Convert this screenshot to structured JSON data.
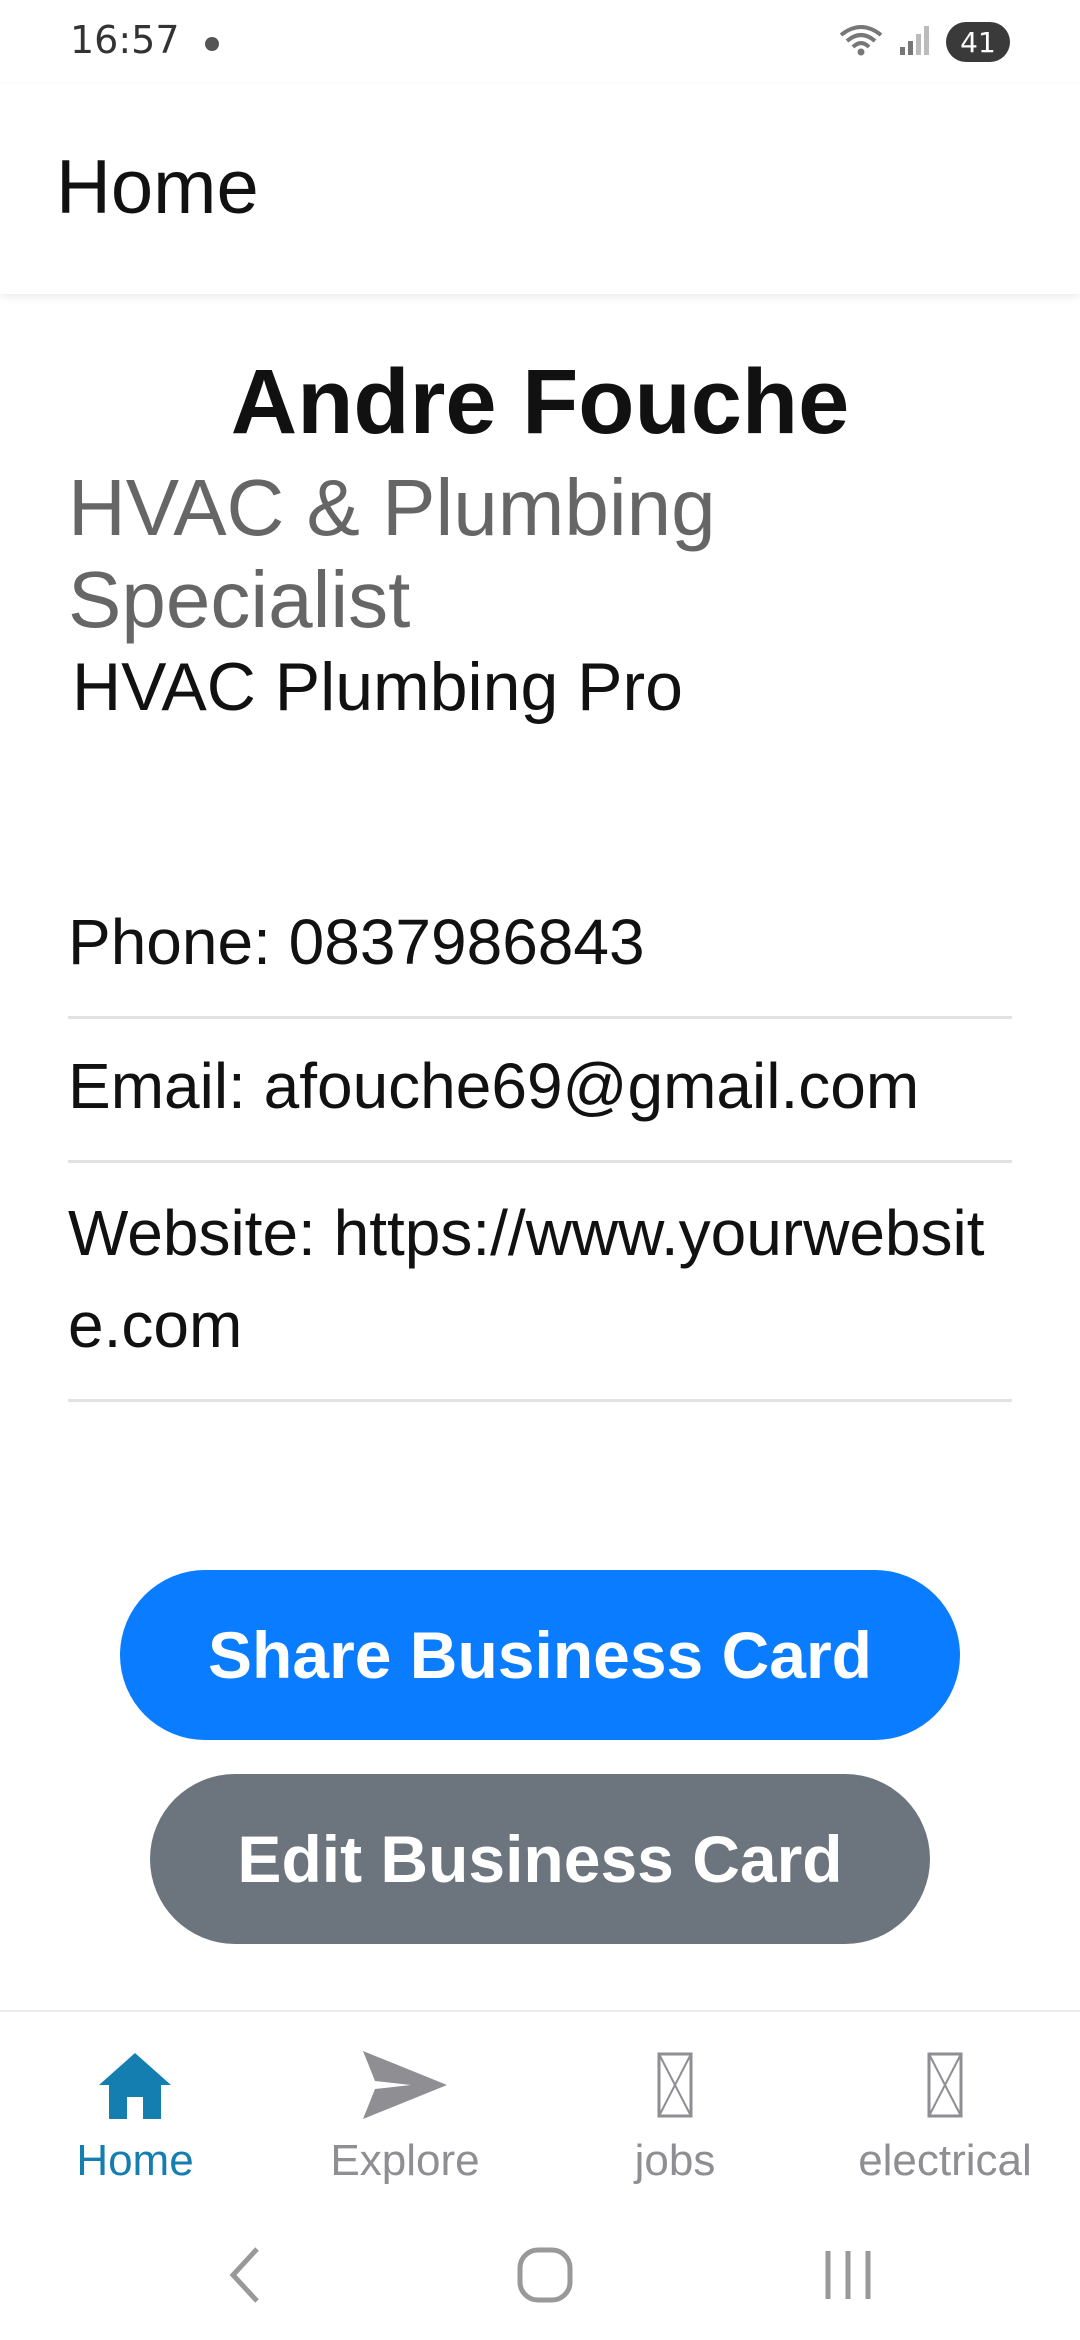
{
  "status_bar": {
    "time": "16:57",
    "battery": "41"
  },
  "header": {
    "title": "Home"
  },
  "card": {
    "name": "Andre Fouche",
    "title": "HVAC & Plumbing Specialist",
    "company": "HVAC Plumbing Pro",
    "phone": "Phone: 0837986843",
    "email": "Email: afouche69@gmail.com",
    "website": "Website: https://www.yourwebsite.com"
  },
  "buttons": {
    "share_label": "Share Business Card",
    "edit_label": "Edit Business Card"
  },
  "tabs": [
    {
      "label": "Home",
      "icon": "home-icon",
      "active": true
    },
    {
      "label": "Explore",
      "icon": "send-icon",
      "active": false
    },
    {
      "label": "jobs",
      "icon": "placeholder-icon",
      "active": false
    },
    {
      "label": "electrical",
      "icon": "placeholder-icon",
      "active": false
    }
  ],
  "colors": {
    "primary_button": "#0a7cff",
    "secondary_button": "#6c757d",
    "active_tab": "#147eb0",
    "inactive_tab": "#8e8e93"
  }
}
